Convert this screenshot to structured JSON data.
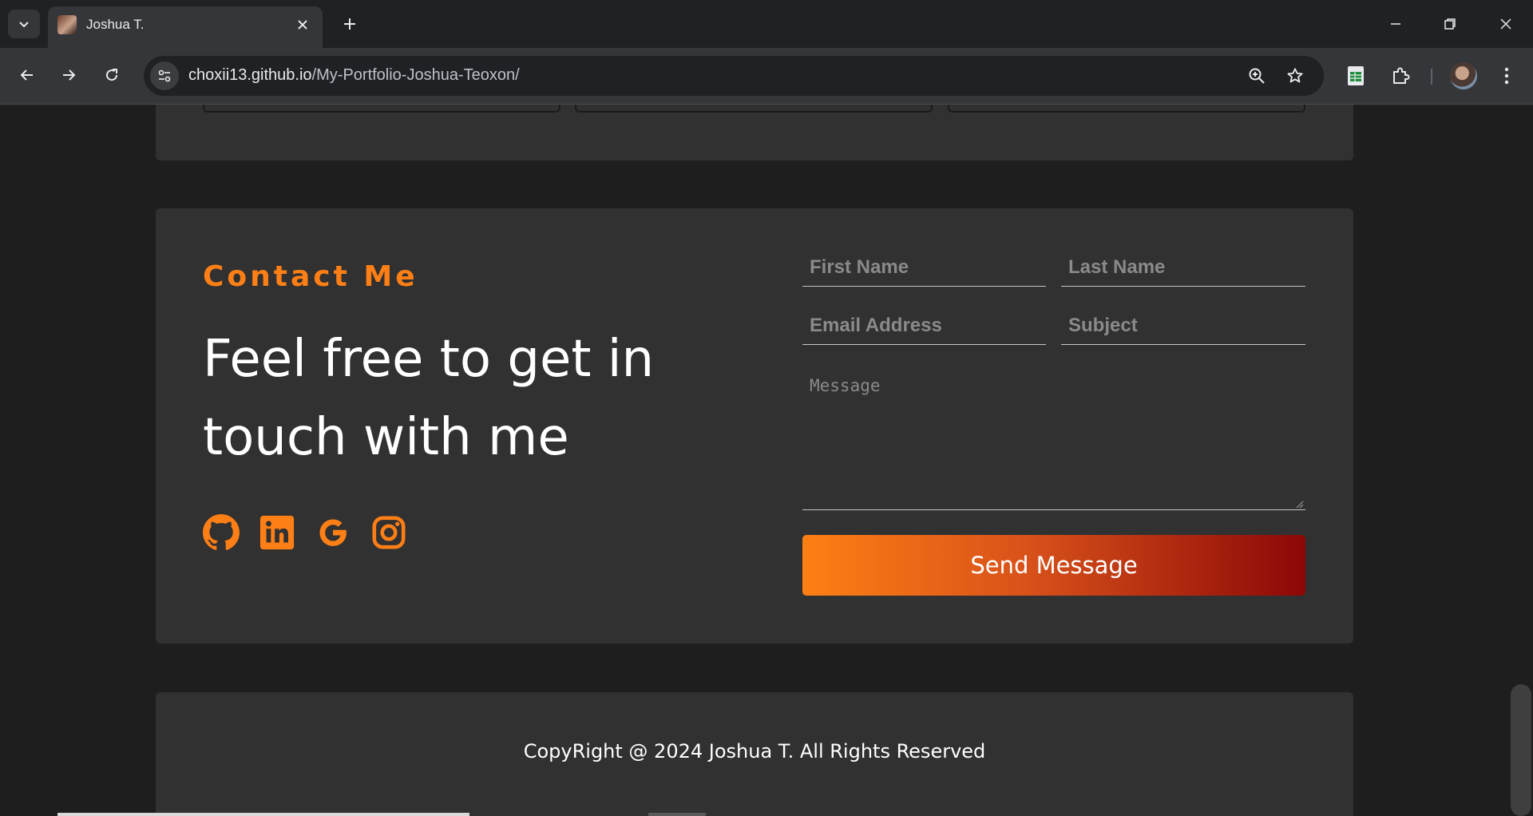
{
  "browser": {
    "tab_title": "Joshua T.",
    "url_host": "choxii13.github.io",
    "url_path": "/My-Portfolio-Joshua-Teoxon/",
    "icons": [
      "tab-search-icon",
      "close-icon",
      "plus-icon",
      "minimize-icon",
      "restore-icon",
      "window-close-icon",
      "back-icon",
      "forward-icon",
      "reload-icon",
      "site-settings-icon",
      "zoom-icon",
      "bookmark-star-icon",
      "sheets-extension-icon",
      "extensions-puzzle-icon",
      "kebab-menu-icon"
    ]
  },
  "contact": {
    "eyebrow": "Contact Me",
    "headline": "Feel free to get in touch with me",
    "socials": [
      "github-icon",
      "linkedin-icon",
      "google-icon",
      "instagram-icon"
    ],
    "form": {
      "first_name_placeholder": "First Name",
      "last_name_placeholder": "Last Name",
      "email_placeholder": "Email Address",
      "subject_placeholder": "Subject",
      "message_placeholder": "Message",
      "send_label": "Send Message"
    }
  },
  "footer": {
    "copyright": "CopyRight @ 2024 Joshua T. All Rights Reserved"
  },
  "colors": {
    "accent": "#fd7f16",
    "button_gradient_start": "#fd8014",
    "button_gradient_end": "#8c0707",
    "card_bg": "#313131",
    "page_bg": "#1e1e1e"
  }
}
